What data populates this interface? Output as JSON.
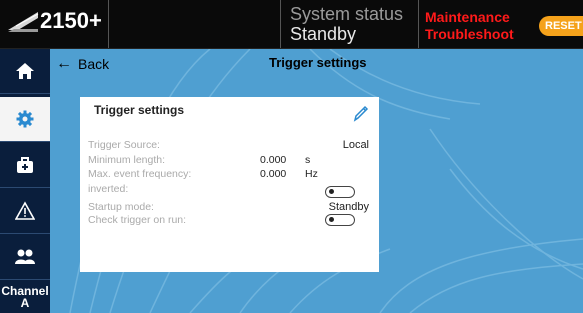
{
  "app": {
    "model": "2150+"
  },
  "status": {
    "title": "System status",
    "value": "Standby"
  },
  "alerts": {
    "line1": "Maintenance",
    "line2": "Troubleshoot",
    "reset_label": "RESET"
  },
  "sidebar": {
    "items": [
      {
        "icon": "home-icon"
      },
      {
        "icon": "gear-icon",
        "active": true
      },
      {
        "icon": "toolbox-icon"
      },
      {
        "icon": "warning-icon"
      },
      {
        "icon": "users-icon"
      }
    ],
    "channel_line1": "Channel",
    "channel_line2": "A"
  },
  "nav": {
    "back_label": "Back",
    "page_title": "Trigger settings"
  },
  "card": {
    "title": "Trigger settings",
    "rows": {
      "trigger_source": {
        "label": "Trigger Source:",
        "value": "Local"
      },
      "min_length": {
        "label": "Minimum length:",
        "value": "0.000",
        "unit": "s"
      },
      "max_freq": {
        "label": "Max. event frequency:",
        "value": "0.000",
        "unit": "Hz"
      },
      "inverted": {
        "label": "inverted:",
        "toggle_on": false
      },
      "startup_mode": {
        "label": "Startup mode:",
        "value": "Standby"
      },
      "check_trigger": {
        "label": "Check trigger on run:",
        "toggle_on": false
      }
    }
  },
  "colors": {
    "accent_blue": "#4f9fd1",
    "sidebar": "#0a1e3c",
    "alert_red": "#ff1a1a",
    "reset_orange": "#f5a21b"
  }
}
